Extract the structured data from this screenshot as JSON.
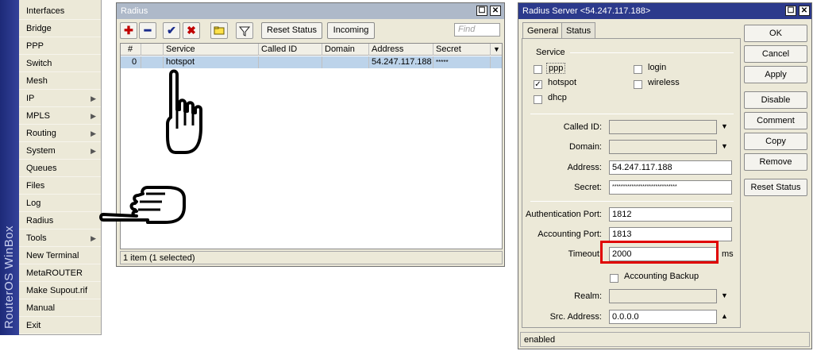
{
  "menu": {
    "brand": "RouterOS WinBox",
    "items": [
      {
        "label": "Interfaces",
        "sub": false
      },
      {
        "label": "Bridge",
        "sub": false
      },
      {
        "label": "PPP",
        "sub": false
      },
      {
        "label": "Switch",
        "sub": false
      },
      {
        "label": "Mesh",
        "sub": false
      },
      {
        "label": "IP",
        "sub": true
      },
      {
        "label": "MPLS",
        "sub": true
      },
      {
        "label": "Routing",
        "sub": true
      },
      {
        "label": "System",
        "sub": true
      },
      {
        "label": "Queues",
        "sub": false
      },
      {
        "label": "Files",
        "sub": false
      },
      {
        "label": "Log",
        "sub": false
      },
      {
        "label": "Radius",
        "sub": false
      },
      {
        "label": "Tools",
        "sub": true
      },
      {
        "label": "New Terminal",
        "sub": false
      },
      {
        "label": "MetaROUTER",
        "sub": false
      },
      {
        "label": "Make Supout.rif",
        "sub": false
      },
      {
        "label": "Manual",
        "sub": false
      },
      {
        "label": "Exit",
        "sub": false
      }
    ]
  },
  "radius_window": {
    "title": "Radius",
    "maximize_glyph": "☐",
    "close_glyph": "✕",
    "toolbar": {
      "add_glyph": "✚",
      "remove_glyph": "━",
      "enable_glyph": "✔",
      "disable_glyph": "✖",
      "reset_status": "Reset Status",
      "incoming": "Incoming",
      "find_placeholder": "Find"
    },
    "columns": [
      "#",
      "Service",
      "Called ID",
      "Domain",
      "Address",
      "Secret"
    ],
    "rows": [
      {
        "num": "0",
        "service": "hotspot",
        "called_id": "",
        "domain": "",
        "address": "54.247.117.188",
        "secret": "*****"
      }
    ],
    "status": "1 item (1 selected)"
  },
  "server_window": {
    "title": "Radius Server <54.247.117.188>",
    "tabs": [
      "General",
      "Status"
    ],
    "service_label": "Service",
    "services": [
      {
        "label": "ppp",
        "checked": false
      },
      {
        "label": "login",
        "checked": false
      },
      {
        "label": "hotspot",
        "checked": true
      },
      {
        "label": "wireless",
        "checked": false
      },
      {
        "label": "dhcp",
        "checked": false
      }
    ],
    "fields": {
      "called_id_label": "Called ID:",
      "called_id": "",
      "domain_label": "Domain:",
      "domain": "",
      "address_label": "Address:",
      "address": "54.247.117.188",
      "secret_label": "Secret:",
      "secret": "******************************",
      "auth_port_label": "Authentication Port:",
      "auth_port": "1812",
      "acct_port_label": "Accounting Port:",
      "acct_port": "1813",
      "timeout_label": "Timeout:",
      "timeout": "2000",
      "timeout_unit": "ms",
      "accounting_backup_label": "Accounting Backup",
      "realm_label": "Realm:",
      "realm": "",
      "src_address_label": "Src. Address:",
      "src_address": "0.0.0.0"
    },
    "buttons": {
      "ok": "OK",
      "cancel": "Cancel",
      "apply": "Apply",
      "disable": "Disable",
      "comment": "Comment",
      "copy": "Copy",
      "remove": "Remove",
      "reset_status": "Reset Status"
    },
    "status": "enabled",
    "highlight_color": "#e00000"
  }
}
